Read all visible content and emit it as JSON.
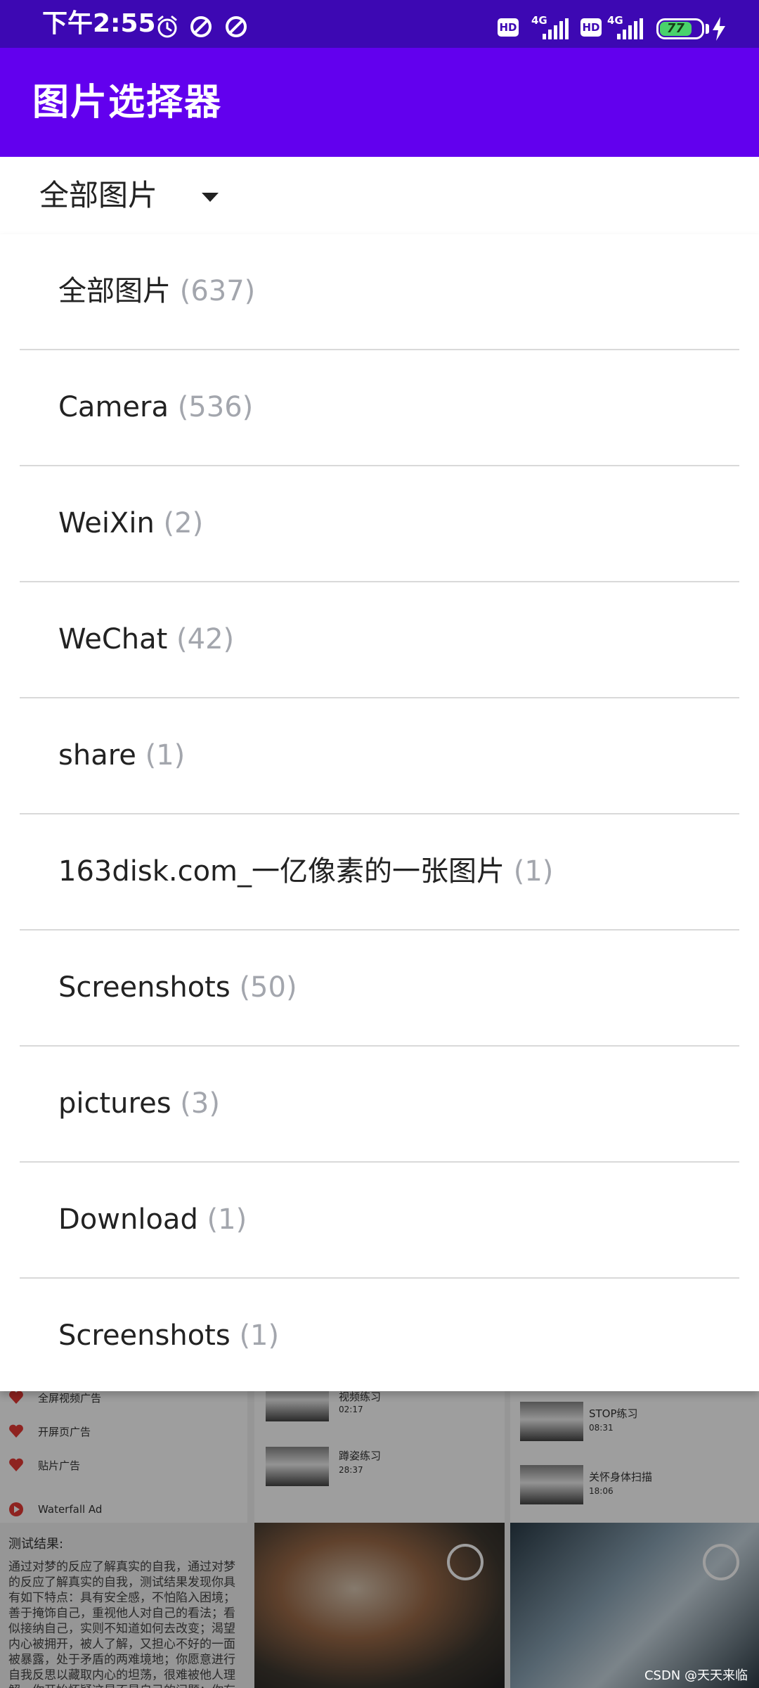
{
  "status_bar": {
    "time": "下午2:55",
    "icons": [
      "alarm-icon",
      "data-saver-icon",
      "data-saver-icon"
    ],
    "hd1": "HD",
    "net1": "4G",
    "hd2": "HD",
    "net2": "4G",
    "battery": "77",
    "battery_fraction": 0.77,
    "charging_icon": "bolt-icon"
  },
  "app_bar": {
    "title": "图片选择器"
  },
  "spinner": {
    "selected": "全部图片",
    "caret_icon": "dropdown-caret-icon"
  },
  "dropdown": {
    "options": [
      {
        "name": "全部图片",
        "count": "(637)"
      },
      {
        "name": "Camera",
        "count": "(536)"
      },
      {
        "name": "WeiXin",
        "count": "(2)"
      },
      {
        "name": "WeChat",
        "count": "(42)"
      },
      {
        "name": "share",
        "count": "(1)"
      },
      {
        "name": "163disk.com_一亿像素的一张图片",
        "count": "(1)"
      },
      {
        "name": "Screenshots",
        "count": "(50)"
      },
      {
        "name": "pictures",
        "count": "(3)"
      },
      {
        "name": "Download",
        "count": "(1)"
      },
      {
        "name": "Screenshots",
        "count": "(1)"
      }
    ]
  },
  "background": {
    "left_rows": [
      "全屏视频广告",
      "开屏页广告",
      "贴片广告",
      "Waterfall Ad"
    ],
    "mid_rows": [
      "视频练习",
      "蹲姿练习"
    ],
    "mid_sub": [
      "02:17",
      "28:37"
    ],
    "right_rows": [
      "STOP练习",
      "关怀身体扫描"
    ],
    "right_sub": [
      "08:31",
      "18:06"
    ],
    "result_title": "测试结果:",
    "result_text": "通过对梦的反应了解真实的自我，通过对梦的反应了解真实的自我，测试结果发现你具有如下特点：具有安全感，不怕陷入困境；善于掩饰自己，重视他人对自己的看法；看似接纳自己，实则不知道如何去改变；渴望内心被拥开，被人了解，又担心不好的一面被暴露，处于矛盾的两难境地；你愿意进行自我反思以藏取内心的坦荡，很难被他人理解，你开始怀疑这是不是自己的问题；你有依赖思想，需要理解自己，你需要更大的勇气。"
  },
  "watermark": "CSDN @天天来临"
}
